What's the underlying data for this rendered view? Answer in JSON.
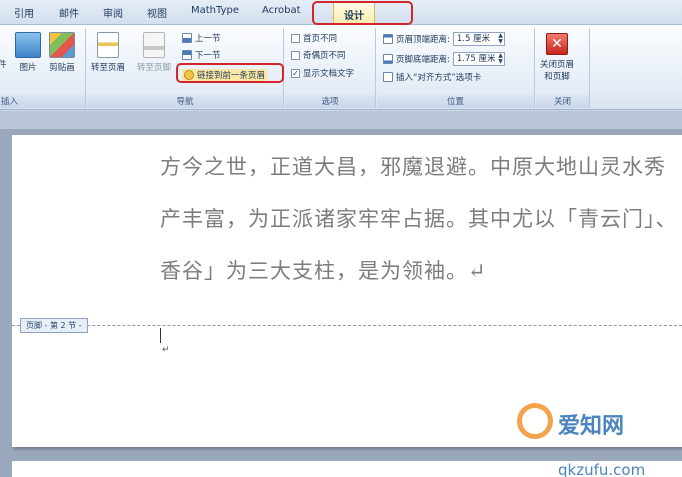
{
  "tabs": [
    "引用",
    "邮件",
    "审阅",
    "视图",
    "MathType",
    "Acrobat",
    "设计"
  ],
  "ribbon": {
    "insert": {
      "items": [
        "件",
        "图片",
        "剪贴画"
      ],
      "label": "插入"
    },
    "nav": {
      "goto_header": "转至页眉",
      "goto_footer": "转至页脚",
      "prev_section": "上一节",
      "next_section": "下一节",
      "link_previous": "链接到前一条页眉",
      "label": "导航"
    },
    "options": {
      "first_page_diff": "首页不同",
      "odd_even_diff": "奇偶页不同",
      "show_doc_text": "显示文档文字",
      "show_doc_text_checked": "✓",
      "label": "选项"
    },
    "position": {
      "header_top_label": "页眉顶端距离:",
      "header_top_value": "1.5 厘米",
      "footer_bottom_label": "页脚底端距离:",
      "footer_bottom_value": "1.75 厘米",
      "insert_align_tab": "插入“对齐方式”选项卡",
      "label": "位置"
    },
    "close": {
      "close_btn_line1": "关闭页眉",
      "close_btn_line2": "和页脚",
      "label": "关闭"
    }
  },
  "document": {
    "lines": [
      "方今之世，正道大昌，邪魔退避。中原大地山灵水秀",
      "产丰富，为正派诸家牢牢占据。其中尤以「青云门」、",
      "香谷」为三大支柱，是为领袖。↵"
    ],
    "footer_tag": "页脚 - 第 2 节 -",
    "footer_mark": "↵"
  },
  "watermark": {
    "line1": "爱知网",
    "line2": "qkzufu.com"
  },
  "colors": {
    "highlight": "#d2262c",
    "active_tab": "#f8eaa8"
  }
}
